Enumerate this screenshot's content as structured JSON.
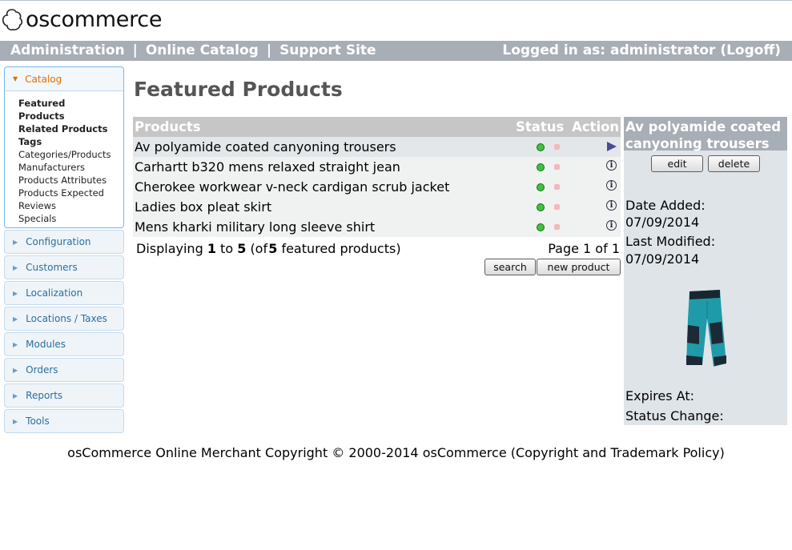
{
  "logo": {
    "text": "oscommerce"
  },
  "topbar": {
    "links": [
      "Administration",
      "Online Catalog",
      "Support Site"
    ],
    "separator": "|",
    "logged_in": "Logged in as: administrator (Logoff)"
  },
  "sidebar": {
    "active": {
      "title": "Catalog",
      "items": [
        {
          "label": "Featured Products",
          "bold": true
        },
        {
          "label": "Related Products",
          "bold": true
        },
        {
          "label": "Tags",
          "bold": true
        },
        {
          "label": "Categories/Products",
          "bold": false
        },
        {
          "label": "Manufacturers",
          "bold": false
        },
        {
          "label": "Products Attributes",
          "bold": false
        },
        {
          "label": "Products Expected",
          "bold": false
        },
        {
          "label": "Reviews",
          "bold": false
        },
        {
          "label": "Specials",
          "bold": false
        }
      ]
    },
    "sections": [
      "Configuration",
      "Customers",
      "Localization",
      "Locations / Taxes",
      "Modules",
      "Orders",
      "Reports",
      "Tools"
    ]
  },
  "main": {
    "title": "Featured Products",
    "columns": {
      "products": "Products",
      "status": "Status",
      "action": "Action"
    },
    "rows": [
      {
        "name": "Av polyamide coated canyoning trousers",
        "selected": true
      },
      {
        "name": "Carhartt b320 mens relaxed straight jean",
        "selected": false
      },
      {
        "name": "Cherokee workwear v-neck cardigan scrub jacket",
        "selected": false
      },
      {
        "name": "Ladies box pleat skirt",
        "selected": false
      },
      {
        "name": "Mens kharki military long sleeve shirt",
        "selected": false
      }
    ],
    "display": {
      "prefix": "Displaying",
      "from": "1",
      "to_word": "to",
      "to": "5",
      "of_prefix": "(of",
      "total": "5",
      "suffix": "featured products)"
    },
    "page_info": "Page 1 of 1",
    "buttons": {
      "search": "search",
      "new_product": "new product"
    }
  },
  "infobox": {
    "title": "Av polyamide coated canyoning trousers",
    "edit": "edit",
    "delete": "delete",
    "date_added_label": "Date Added:",
    "date_added": "07/09/2014",
    "last_modified_label": "Last Modified:",
    "last_modified": "07/09/2014",
    "expires_label": "Expires At:",
    "status_change_label": "Status Change:"
  },
  "footer": {
    "text": "osCommerce Online Merchant Copyright © 2000-2014 osCommerce (Copyright and Trademark Policy)"
  },
  "colors": {
    "topbar": "#a7aeb5",
    "status_on": "#3cc43c",
    "status_off": "#f3b9b9",
    "accordion_active": "#e17009",
    "accordion_text": "#2e6e9e"
  }
}
